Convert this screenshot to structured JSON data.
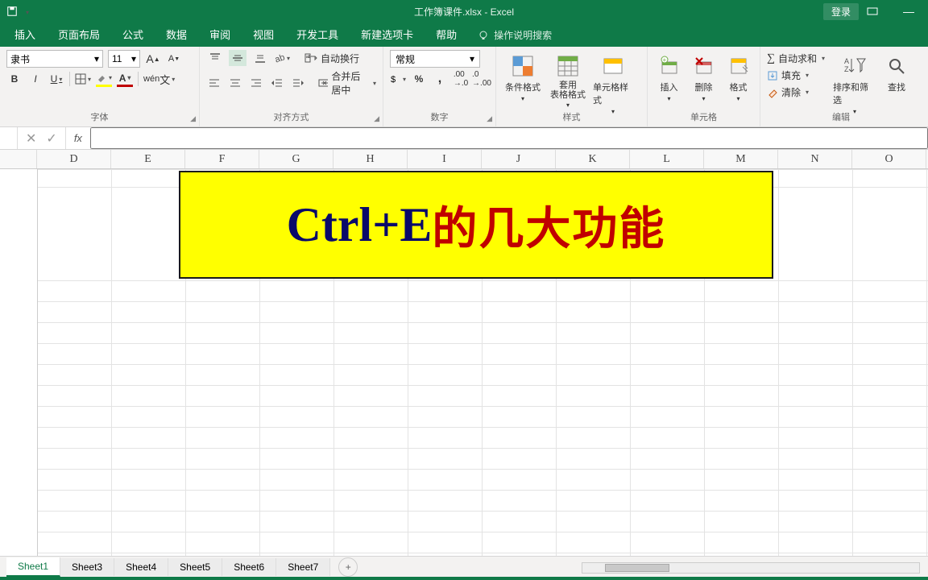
{
  "title": "工作簿课件.xlsx - Excel",
  "login": "登录",
  "tabs": [
    "插入",
    "页面布局",
    "公式",
    "数据",
    "审阅",
    "视图",
    "开发工具",
    "新建选项卡",
    "帮助"
  ],
  "tellme": "操作说明搜索",
  "font": {
    "name": "隶书",
    "size": "11"
  },
  "groups": {
    "font": "字体",
    "align": "对齐方式",
    "number": "数字",
    "styles": "样式",
    "cells": "单元格",
    "editing": "编辑"
  },
  "align": {
    "wrap": "自动换行",
    "merge": "合并后居中"
  },
  "numfmt": "常规",
  "styles": {
    "cond": "条件格式",
    "table": "套用\n表格格式",
    "cell": "单元格样式"
  },
  "cells": {
    "insert": "插入",
    "delete": "删除",
    "format": "格式"
  },
  "editing": {
    "autosum": "自动求和",
    "fill": "填充",
    "clear": "清除",
    "sort": "排序和筛选",
    "find": "查找"
  },
  "columns": [
    "D",
    "E",
    "F",
    "G",
    "H",
    "I",
    "J",
    "K",
    "L",
    "M",
    "N",
    "O"
  ],
  "merged": {
    "black": "Ctrl+E",
    "red": "的几大功能"
  },
  "sheets": [
    "Sheet1",
    "Sheet3",
    "Sheet4",
    "Sheet5",
    "Sheet6",
    "Sheet7"
  ],
  "placeholders": {
    "fx": ""
  }
}
